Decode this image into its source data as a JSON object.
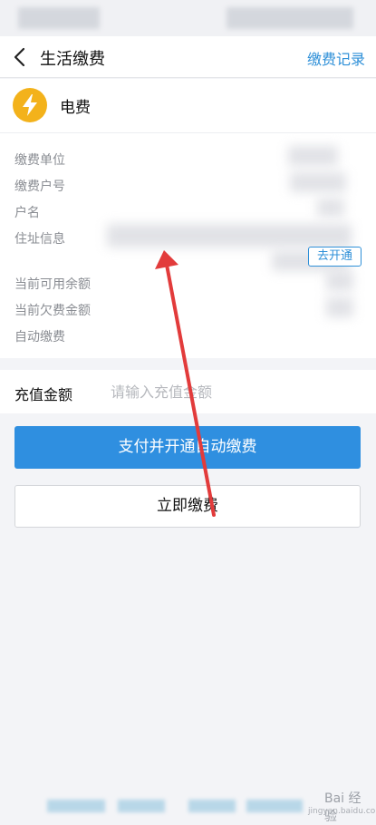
{
  "header": {
    "title": "生活缴费",
    "records_link": "缴费记录"
  },
  "bill": {
    "type_label": "电费",
    "icon": "lightning-bolt-icon",
    "icon_color": "#f3b21b"
  },
  "info": {
    "unit_label": "缴费单位",
    "account_label": "缴费户号",
    "name_label": "户名",
    "address_label": "住址信息",
    "balance_label": "当前可用余额",
    "arrears_label": "当前欠费金额",
    "autopay_label": "自动缴费",
    "autopay_button": "去开通"
  },
  "amount": {
    "label": "充值金额",
    "placeholder": "请输入充值金额",
    "value": ""
  },
  "actions": {
    "pay_and_autopay": "支付并开通自动缴费",
    "pay_now": "立即缴费"
  },
  "watermark": {
    "text": "Bai 经验",
    "sub": "jingyan.baidu.com"
  },
  "colors": {
    "accent": "#2f90d8",
    "primary_button": "#2f8fe0",
    "annotation_arrow": "#e23b3b"
  }
}
